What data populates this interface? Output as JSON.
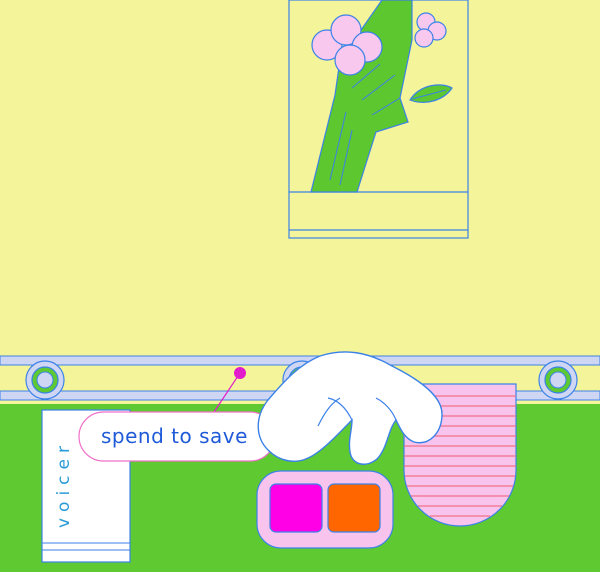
{
  "scene": {
    "tagline": "spend to save",
    "card_text": "voicer"
  },
  "colors": {
    "sky": "#f4f49a",
    "counter": "#5fc931",
    "rail": "#cfd6f3",
    "outline": "#3b82e8",
    "pill_fill": "#ffffff",
    "pill_border": "#f070c8",
    "pin": "#e21ccc",
    "wallet": "#f8c4ee",
    "button_magenta": "#ff00e6",
    "button_orange": "#ff6600",
    "stem": "#5cc72f",
    "flower": "#f8c8ee",
    "receipt_line": "#f07088"
  }
}
